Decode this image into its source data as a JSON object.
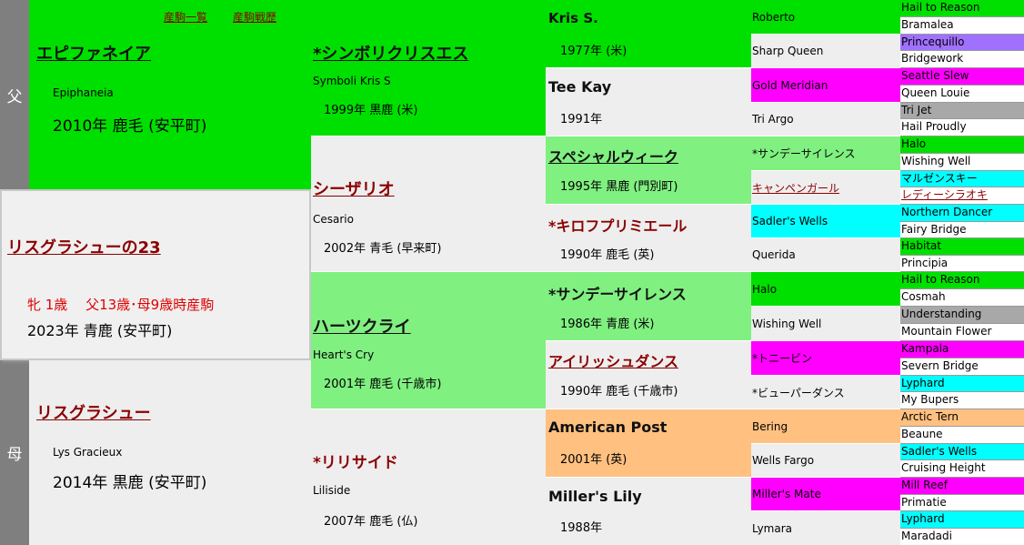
{
  "sire_side_label": "父",
  "dam_side_label": "母",
  "top_links": [
    "産駒一覧",
    "産駒戦歴"
  ],
  "sire": {
    "name": "エピファネイア",
    "en": "Epiphaneia",
    "info": "2010年 鹿毛 (安平町)"
  },
  "subject": {
    "name": "リスグラシューの23",
    "line1": "牝 1歳　 父13歳･母9歳時産駒",
    "line2": "2023年 青鹿 (安平町)"
  },
  "dam": {
    "name": "リスグラシュー",
    "en": "Lys Gracieux",
    "info": "2014年 黒鹿 (安平町)"
  },
  "gen2": [
    {
      "name": "*シンボリクリスエス",
      "en": "Symboli Kris S",
      "info": "1999年 黒鹿 (米)"
    },
    {
      "name": "シーザリオ",
      "en": "Cesario",
      "info": "2002年 青毛 (早来町)"
    },
    {
      "name": "ハーツクライ",
      "en": "Heart's Cry",
      "info": "2001年 鹿毛 (千歳市)"
    },
    {
      "name": "*リリサイド",
      "en": "Liliside",
      "info": "2007年 鹿毛 (仏)"
    }
  ],
  "gen3": [
    {
      "name": "Kris S.",
      "info": "1977年 (米)"
    },
    {
      "name": "Tee Kay",
      "info": "1991年"
    },
    {
      "name": "スペシャルウィーク",
      "info": "1995年 黒鹿 (門別町)"
    },
    {
      "name": "*キロフプリミエール",
      "info": "1990年 鹿毛 (英)"
    },
    {
      "name": "*サンデーサイレンス",
      "info": "1986年 青鹿 (米)"
    },
    {
      "name": "アイリッシュダンス",
      "info": "1990年 鹿毛 (千歳市)"
    },
    {
      "name": "American Post",
      "info": "2001年 (英)"
    },
    {
      "name": "Miller's Lily",
      "info": "1988年"
    }
  ],
  "gen4": [
    "Roberto",
    "Sharp Queen",
    "Gold Meridian",
    "Tri Argo",
    "*サンデーサイレンス",
    "キャンペンガール",
    "Sadler's Wells",
    "Querida",
    "Halo",
    "Wishing Well",
    "*トニービン",
    "*ビューパーダンス",
    "Bering",
    "Wells Fargo",
    "Miller's Mate",
    "Lymara"
  ],
  "gen5": [
    "Hail to Reason",
    "Bramalea",
    "Princequillo",
    "Bridgework",
    "Seattle Slew",
    "Queen Louie",
    "Tri Jet",
    "Hail Proudly",
    "Halo",
    "Wishing Well",
    "マルゼンスキー",
    "レディーシラオキ",
    "Northern Dancer",
    "Fairy Bridge",
    "Habitat",
    "Principia",
    "Hail to Reason",
    "Cosmah",
    "Understanding",
    "Mountain Flower",
    "Kampala",
    "Severn Bridge",
    "Lyphard",
    "My Bupers",
    "Arctic Tern",
    "Beaune",
    "Sadler's Wells",
    "Cruising Height",
    "Mill Reef",
    "Primatie",
    "Lyphard",
    "Maradadi"
  ],
  "colors": {
    "green": "#00e000",
    "light_green": "#80f080",
    "light_gray": "#eeeeee",
    "orange": "#ffc080",
    "magenta": "#ff00ff",
    "cyan": "#00ffff",
    "purple": "#a070ff",
    "gray": "#a8a8a8",
    "side_gray": "#7f7f7f",
    "link_red": "#8b0000",
    "info_red": "#e00000"
  }
}
